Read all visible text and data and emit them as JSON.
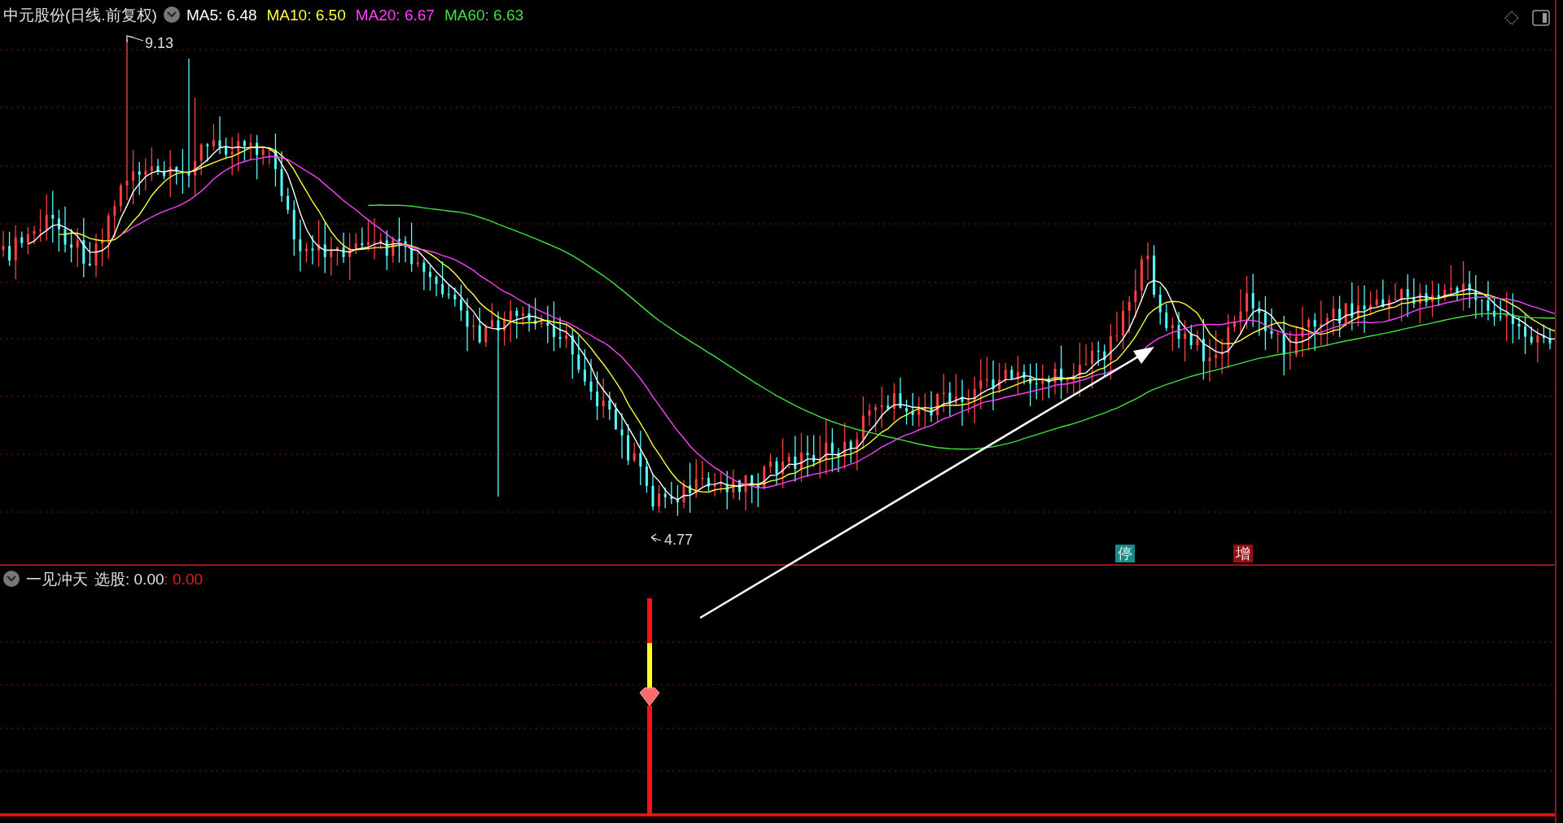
{
  "main_chart": {
    "title": "中元股份(日线.前复权)",
    "ma_legend": [
      {
        "label": "MA5: 6.48",
        "color": "#ffffff"
      },
      {
        "label": "MA10: 6.50",
        "color": "#ffff40"
      },
      {
        "label": "MA20: 6.67",
        "color": "#ff40ff"
      },
      {
        "label": "MA60: 6.63",
        "color": "#40e040"
      }
    ],
    "high_label": "9.13",
    "low_label": "4.77",
    "signals": [
      {
        "text": "停",
        "color": "#168a8a"
      },
      {
        "text": "增",
        "color": "#9a1010"
      }
    ]
  },
  "indicator": {
    "name": "一见冲天",
    "label": "选股: 0.00",
    "value": ": 0.00"
  }
}
